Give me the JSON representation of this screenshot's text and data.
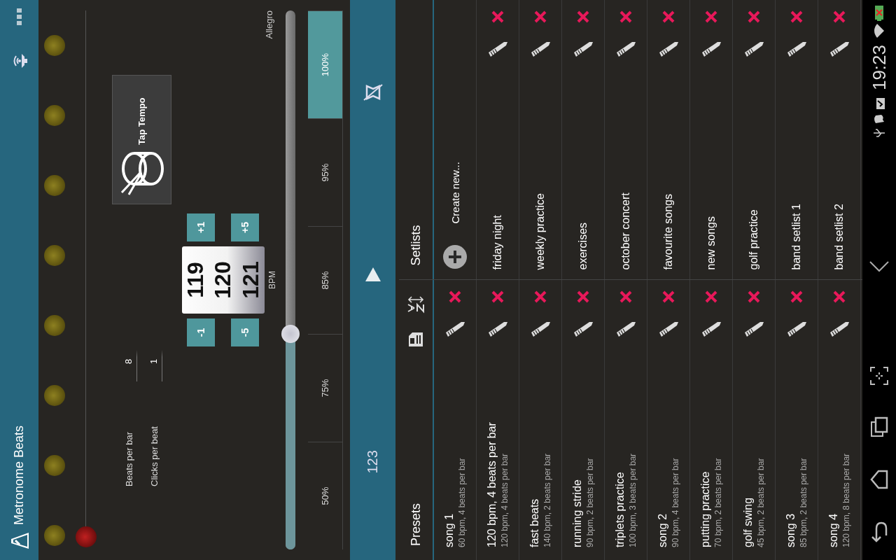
{
  "app_bar": {
    "title": "Metronome Beats"
  },
  "time_signature": [
    {
      "label": "Beats per bar",
      "value": "8"
    },
    {
      "label": "Clicks per beat",
      "value": "1"
    }
  ],
  "tap_tempo": {
    "label": "Tap Tempo"
  },
  "bpm": {
    "minus": [
      "-1",
      "-5"
    ],
    "plus": [
      "+1",
      "+5"
    ],
    "drum": [
      "119",
      "120",
      "121"
    ],
    "unit": "BPM",
    "tempo_name": "Allegro",
    "level": 0.4
  },
  "speed_presets": [
    {
      "label": "50%",
      "selected": false
    },
    {
      "label": "75%",
      "selected": false
    },
    {
      "label": "85%",
      "selected": false
    },
    {
      "label": "95%",
      "selected": false
    },
    {
      "label": "100%",
      "selected": true
    }
  ],
  "transport": {
    "counter": "123"
  },
  "presets": {
    "title": "Presets",
    "items": [
      {
        "name": "song 1",
        "detail": "60 bpm, 4 beats per bar"
      },
      {
        "name": "120 bpm, 4 beats per bar",
        "detail": "120 bpm, 4 beats per bar"
      },
      {
        "name": "fast beats",
        "detail": "140 bpm, 2 beats per bar"
      },
      {
        "name": "running stride",
        "detail": "90 bpm, 2 beats per bar"
      },
      {
        "name": "triplets practice",
        "detail": "100 bpm, 3 beats per bar"
      },
      {
        "name": "song 2",
        "detail": "90 bpm, 4 beats per bar"
      },
      {
        "name": "putting practice",
        "detail": "70 bpm, 2 beats per bar"
      },
      {
        "name": "golf swing",
        "detail": "45 bpm, 2 beats per bar"
      },
      {
        "name": "song 3",
        "detail": "85 bpm, 2 beats per bar"
      },
      {
        "name": "song 4",
        "detail": "120 bpm, 8 beats per bar"
      }
    ]
  },
  "setlists": {
    "title": "Setlists",
    "create": "Create new...",
    "items": [
      {
        "name": "friday night"
      },
      {
        "name": "weekly practice"
      },
      {
        "name": "exercises"
      },
      {
        "name": "october concert"
      },
      {
        "name": "favourite songs"
      },
      {
        "name": "new songs"
      },
      {
        "name": "golf practice"
      },
      {
        "name": "band setlist 1"
      },
      {
        "name": "band setlist 2"
      }
    ]
  },
  "status_bar": {
    "time": "19:23"
  }
}
